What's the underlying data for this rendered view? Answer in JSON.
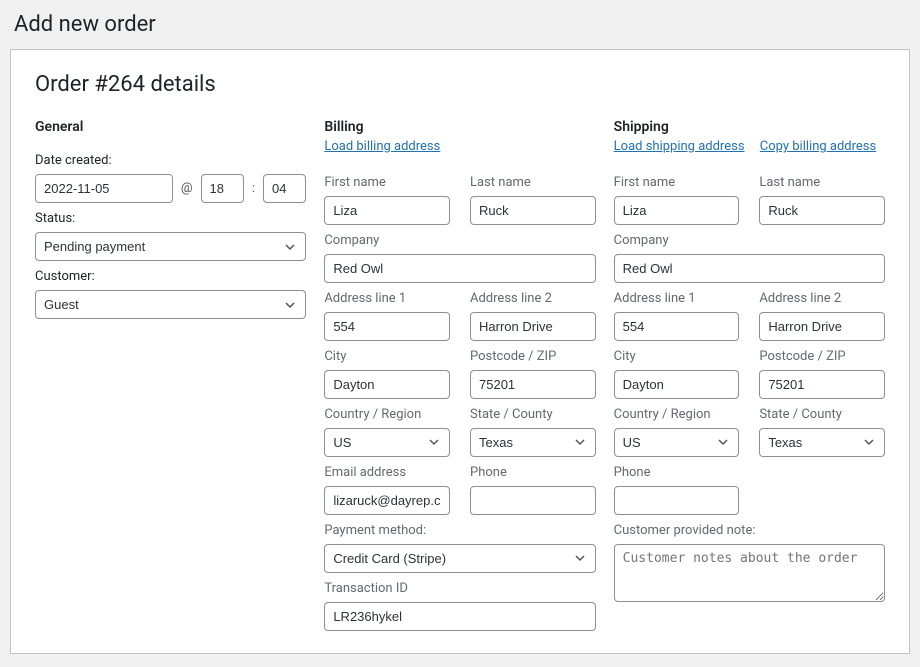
{
  "page_title": "Add new order",
  "order_title": "Order #264 details",
  "general": {
    "heading": "General",
    "date_label": "Date created:",
    "date": "2022-11-05",
    "at": "@",
    "hour": "18",
    "minute": "04",
    "status_label": "Status:",
    "status": "Pending payment",
    "customer_label": "Customer:",
    "customer": "Guest"
  },
  "billing": {
    "heading": "Billing",
    "load_link": "Load billing address",
    "first_name_label": "First name",
    "first_name": "Liza",
    "last_name_label": "Last name",
    "last_name": "Ruck",
    "company_label": "Company",
    "company": "Red Owl",
    "addr1_label": "Address line 1",
    "addr1": "554",
    "addr2_label": "Address line 2",
    "addr2": "Harron Drive",
    "city_label": "City",
    "city": "Dayton",
    "postcode_label": "Postcode / ZIP",
    "postcode": "75201",
    "country_label": "Country / Region",
    "country": "US",
    "state_label": "State / County",
    "state": "Texas",
    "email_label": "Email address",
    "email": "lizaruck@dayrep.c",
    "phone_label": "Phone",
    "phone": "",
    "payment_label": "Payment method:",
    "payment": "Credit Card (Stripe)",
    "txn_label": "Transaction ID",
    "txn": "LR236hykel"
  },
  "shipping": {
    "heading": "Shipping",
    "load_link": "Load shipping address",
    "copy_link": "Copy billing address",
    "first_name_label": "First name",
    "first_name": "Liza",
    "last_name_label": "Last name",
    "last_name": "Ruck",
    "company_label": "Company",
    "company": "Red Owl",
    "addr1_label": "Address line 1",
    "addr1": "554",
    "addr2_label": "Address line 2",
    "addr2": "Harron Drive",
    "city_label": "City",
    "city": "Dayton",
    "postcode_label": "Postcode / ZIP",
    "postcode": "75201",
    "country_label": "Country / Region",
    "country": "US",
    "state_label": "State / County",
    "state": "Texas",
    "phone_label": "Phone",
    "phone": "",
    "note_label": "Customer provided note:",
    "note_placeholder": "Customer notes about the order"
  }
}
